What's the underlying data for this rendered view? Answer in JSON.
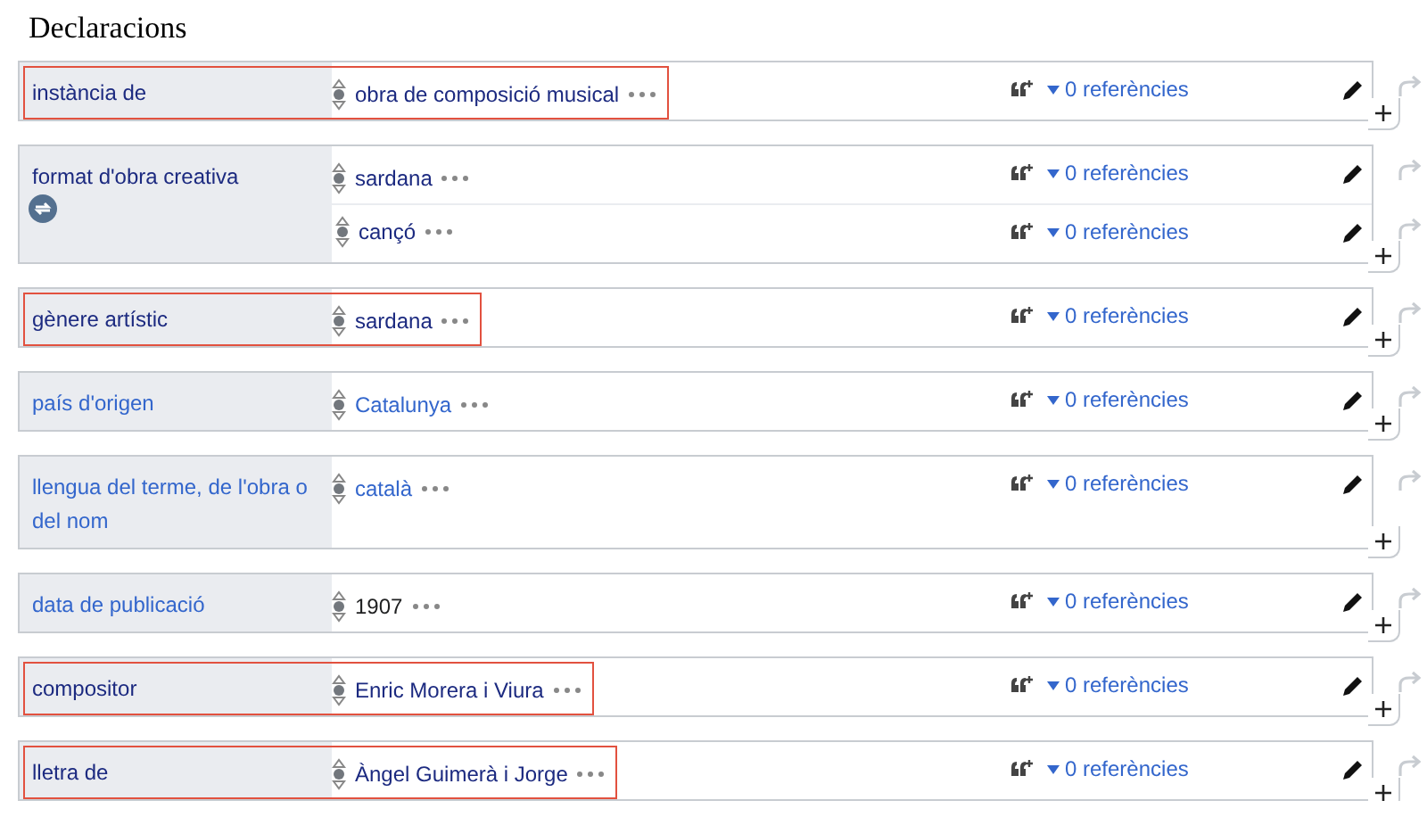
{
  "heading": "Declaracions",
  "statements": [
    {
      "property": {
        "label": "instància de",
        "visited": true
      },
      "highlighted": true,
      "values": [
        {
          "text": "obra de composició musical",
          "kind": "item",
          "visited": true,
          "references": "0 referències"
        }
      ]
    },
    {
      "property": {
        "label": "format d'obra creativa",
        "visited": true
      },
      "highlighted": false,
      "sync_icon": true,
      "values": [
        {
          "text": "sardana",
          "kind": "item",
          "visited": true,
          "references": "0 referències"
        },
        {
          "text": "cançó",
          "kind": "item",
          "visited": true,
          "references": "0 referències"
        }
      ]
    },
    {
      "property": {
        "label": "gènere artístic",
        "visited": true
      },
      "highlighted": true,
      "values": [
        {
          "text": "sardana",
          "kind": "item",
          "visited": true,
          "references": "0 referències"
        }
      ]
    },
    {
      "property": {
        "label": "país d'origen",
        "visited": false
      },
      "highlighted": false,
      "values": [
        {
          "text": "Catalunya",
          "kind": "item",
          "visited": false,
          "references": "0 referències"
        }
      ]
    },
    {
      "property": {
        "label": "llengua del terme, de l'obra o del nom",
        "visited": false
      },
      "highlighted": false,
      "values": [
        {
          "text": "català",
          "kind": "item",
          "visited": false,
          "references": "0 referències"
        }
      ]
    },
    {
      "property": {
        "label": "data de publicació",
        "visited": false
      },
      "highlighted": false,
      "values": [
        {
          "text": "1907",
          "kind": "text",
          "references": "0 referències"
        }
      ]
    },
    {
      "property": {
        "label": "compositor",
        "visited": true
      },
      "highlighted": true,
      "values": [
        {
          "text": "Enric Morera i Viura",
          "kind": "item",
          "visited": true,
          "references": "0 referències"
        }
      ]
    },
    {
      "property": {
        "label": "lletra de",
        "visited": true
      },
      "highlighted": true,
      "values": [
        {
          "text": "Àngel Guimerà i Jorge",
          "kind": "item",
          "visited": true,
          "references": "0 referències"
        }
      ]
    }
  ]
}
